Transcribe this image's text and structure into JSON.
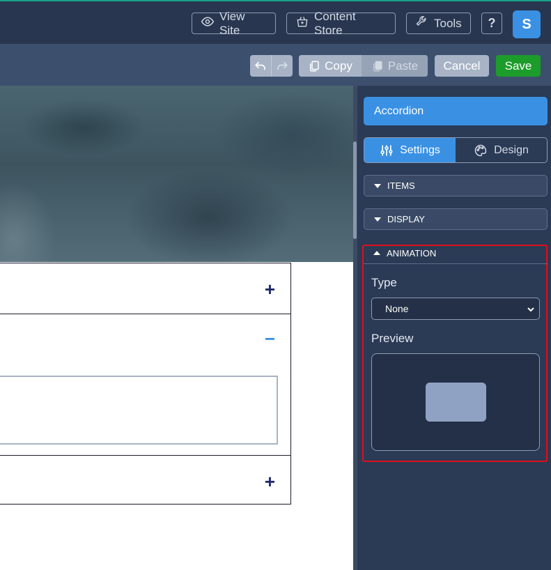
{
  "topbar": {
    "view_site": "View Site",
    "content_store": "Content Store",
    "tools": "Tools",
    "help": "?",
    "avatar": "S"
  },
  "toolbar": {
    "copy": "Copy",
    "paste": "Paste",
    "cancel": "Cancel",
    "save": "Save"
  },
  "canvas": {
    "accordion_rows": [
      {
        "state": "collapsed",
        "icon": "+"
      },
      {
        "state": "expanded",
        "icon": "−"
      },
      {
        "state": "collapsed",
        "icon": "+"
      }
    ]
  },
  "panel": {
    "title": "Accordion",
    "tabs": [
      {
        "label": "Settings",
        "icon": "sliders-icon",
        "active": true
      },
      {
        "label": "Design",
        "icon": "palette-icon",
        "active": false
      }
    ],
    "sections": [
      {
        "label": "ITEMS",
        "expanded": false
      },
      {
        "label": "DISPLAY",
        "expanded": false
      },
      {
        "label": "ANIMATION",
        "expanded": true
      }
    ],
    "animation": {
      "type_label": "Type",
      "type_value": "None",
      "preview_label": "Preview"
    }
  },
  "colors": {
    "topbar": "#283650",
    "toolbar": "#3c506e",
    "panel": "#2b3a55",
    "accent": "#3a91e4",
    "save": "#1c9c2a",
    "highlight": "#e00f1d"
  }
}
